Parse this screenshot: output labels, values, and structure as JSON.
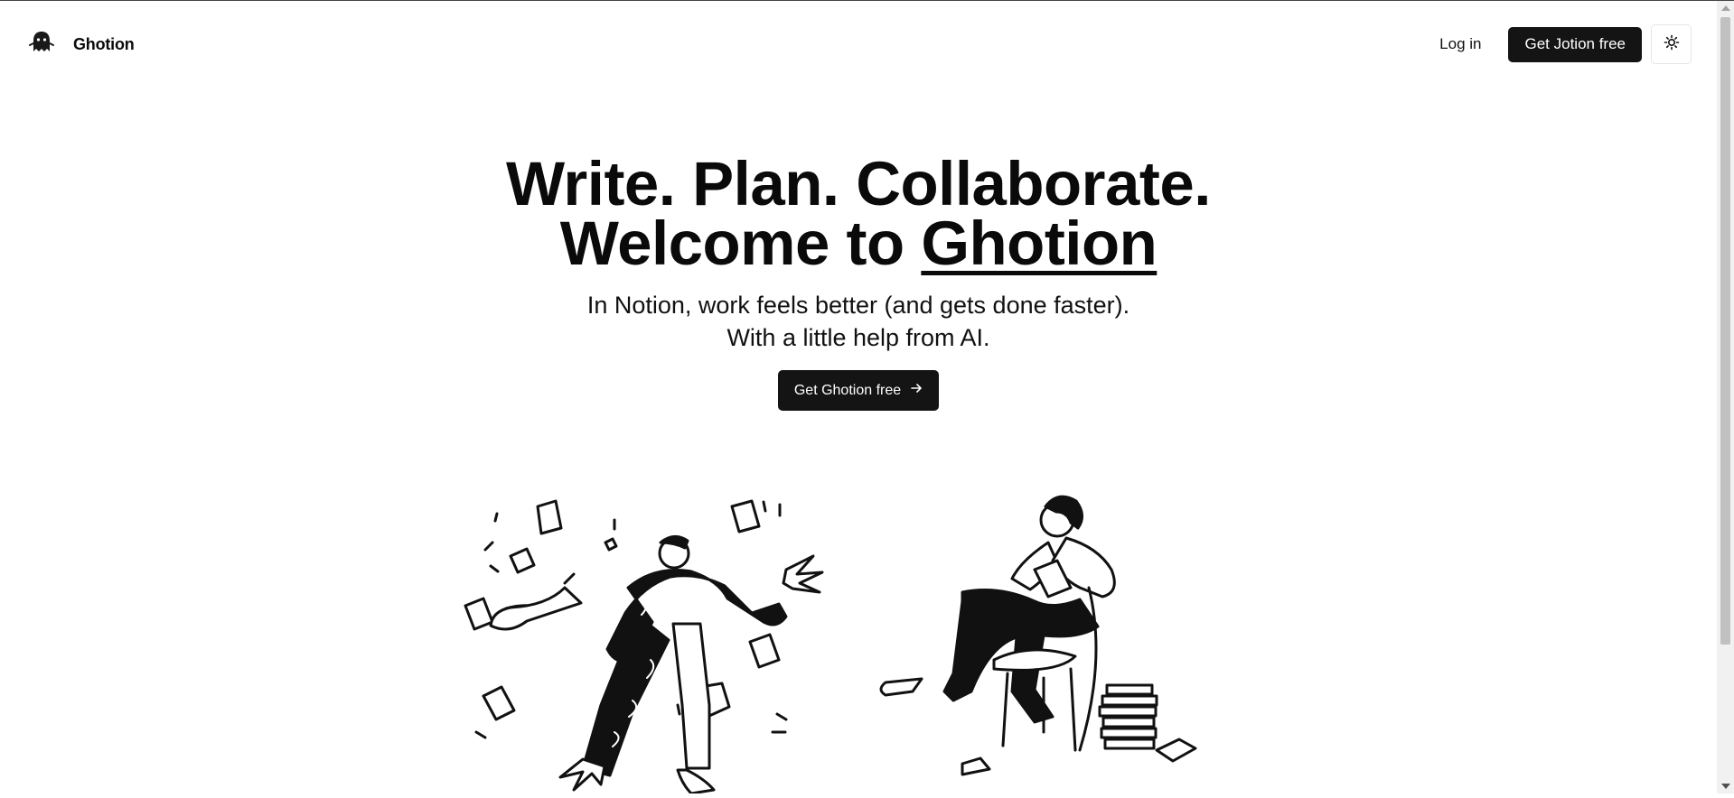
{
  "brand": {
    "name": "Ghotion",
    "logo_icon": "ghost-icon"
  },
  "nav": {
    "login_label": "Log in",
    "signup_label": "Get Jotion free",
    "theme_icon": "sun-icon"
  },
  "hero": {
    "title_line1": "Write. Plan. Collaborate.",
    "title_line2_prefix": "Welcome to ",
    "title_line2_brand": "Ghotion",
    "subtitle_line1": "In Notion, work feels better (and gets done faster).",
    "subtitle_line2": "With a little help from AI.",
    "cta_label": "Get Ghotion free",
    "cta_icon": "arrow-right-icon"
  },
  "colors": {
    "primary": "#141414",
    "background": "#ffffff",
    "text": "#0a0a0a"
  }
}
